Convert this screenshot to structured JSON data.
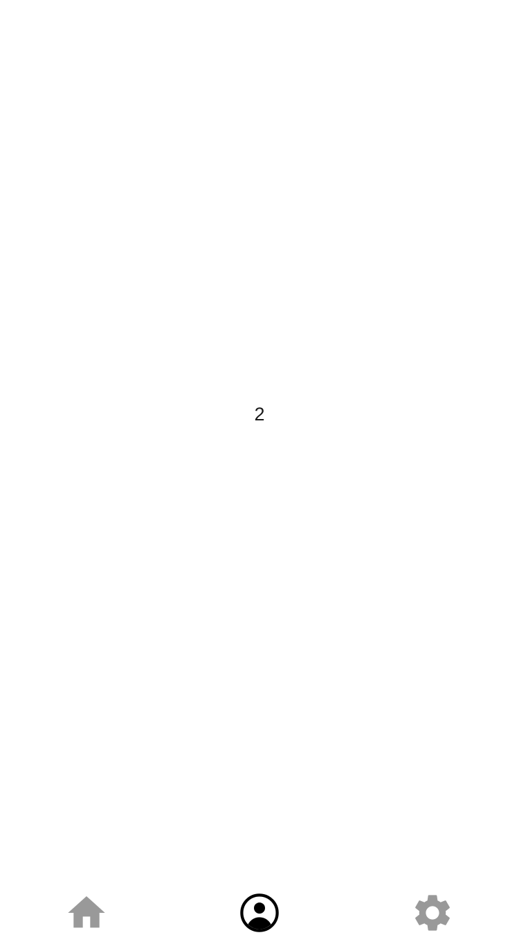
{
  "screen": {
    "page_number": "2"
  },
  "tab_bar": {
    "active_index": 1,
    "tabs": [
      {
        "icon": "home-icon",
        "active": false
      },
      {
        "icon": "account-circle-icon",
        "active": true
      },
      {
        "icon": "gear-icon",
        "active": false
      }
    ],
    "colors": {
      "active": "#000000",
      "inactive": "#999999"
    }
  }
}
